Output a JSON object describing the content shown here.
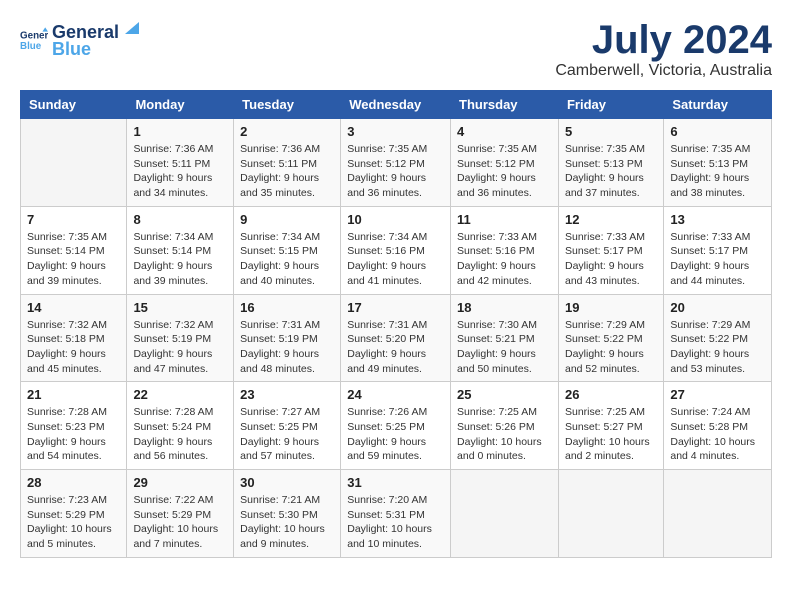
{
  "logo": {
    "line1": "General",
    "line2": "Blue"
  },
  "title": "July 2024",
  "subtitle": "Camberwell, Victoria, Australia",
  "days_header": [
    "Sunday",
    "Monday",
    "Tuesday",
    "Wednesday",
    "Thursday",
    "Friday",
    "Saturday"
  ],
  "weeks": [
    [
      {
        "num": "",
        "info": ""
      },
      {
        "num": "1",
        "info": "Sunrise: 7:36 AM\nSunset: 5:11 PM\nDaylight: 9 hours\nand 34 minutes."
      },
      {
        "num": "2",
        "info": "Sunrise: 7:36 AM\nSunset: 5:11 PM\nDaylight: 9 hours\nand 35 minutes."
      },
      {
        "num": "3",
        "info": "Sunrise: 7:35 AM\nSunset: 5:12 PM\nDaylight: 9 hours\nand 36 minutes."
      },
      {
        "num": "4",
        "info": "Sunrise: 7:35 AM\nSunset: 5:12 PM\nDaylight: 9 hours\nand 36 minutes."
      },
      {
        "num": "5",
        "info": "Sunrise: 7:35 AM\nSunset: 5:13 PM\nDaylight: 9 hours\nand 37 minutes."
      },
      {
        "num": "6",
        "info": "Sunrise: 7:35 AM\nSunset: 5:13 PM\nDaylight: 9 hours\nand 38 minutes."
      }
    ],
    [
      {
        "num": "7",
        "info": "Sunrise: 7:35 AM\nSunset: 5:14 PM\nDaylight: 9 hours\nand 39 minutes."
      },
      {
        "num": "8",
        "info": "Sunrise: 7:34 AM\nSunset: 5:14 PM\nDaylight: 9 hours\nand 39 minutes."
      },
      {
        "num": "9",
        "info": "Sunrise: 7:34 AM\nSunset: 5:15 PM\nDaylight: 9 hours\nand 40 minutes."
      },
      {
        "num": "10",
        "info": "Sunrise: 7:34 AM\nSunset: 5:16 PM\nDaylight: 9 hours\nand 41 minutes."
      },
      {
        "num": "11",
        "info": "Sunrise: 7:33 AM\nSunset: 5:16 PM\nDaylight: 9 hours\nand 42 minutes."
      },
      {
        "num": "12",
        "info": "Sunrise: 7:33 AM\nSunset: 5:17 PM\nDaylight: 9 hours\nand 43 minutes."
      },
      {
        "num": "13",
        "info": "Sunrise: 7:33 AM\nSunset: 5:17 PM\nDaylight: 9 hours\nand 44 minutes."
      }
    ],
    [
      {
        "num": "14",
        "info": "Sunrise: 7:32 AM\nSunset: 5:18 PM\nDaylight: 9 hours\nand 45 minutes."
      },
      {
        "num": "15",
        "info": "Sunrise: 7:32 AM\nSunset: 5:19 PM\nDaylight: 9 hours\nand 47 minutes."
      },
      {
        "num": "16",
        "info": "Sunrise: 7:31 AM\nSunset: 5:19 PM\nDaylight: 9 hours\nand 48 minutes."
      },
      {
        "num": "17",
        "info": "Sunrise: 7:31 AM\nSunset: 5:20 PM\nDaylight: 9 hours\nand 49 minutes."
      },
      {
        "num": "18",
        "info": "Sunrise: 7:30 AM\nSunset: 5:21 PM\nDaylight: 9 hours\nand 50 minutes."
      },
      {
        "num": "19",
        "info": "Sunrise: 7:29 AM\nSunset: 5:22 PM\nDaylight: 9 hours\nand 52 minutes."
      },
      {
        "num": "20",
        "info": "Sunrise: 7:29 AM\nSunset: 5:22 PM\nDaylight: 9 hours\nand 53 minutes."
      }
    ],
    [
      {
        "num": "21",
        "info": "Sunrise: 7:28 AM\nSunset: 5:23 PM\nDaylight: 9 hours\nand 54 minutes."
      },
      {
        "num": "22",
        "info": "Sunrise: 7:28 AM\nSunset: 5:24 PM\nDaylight: 9 hours\nand 56 minutes."
      },
      {
        "num": "23",
        "info": "Sunrise: 7:27 AM\nSunset: 5:25 PM\nDaylight: 9 hours\nand 57 minutes."
      },
      {
        "num": "24",
        "info": "Sunrise: 7:26 AM\nSunset: 5:25 PM\nDaylight: 9 hours\nand 59 minutes."
      },
      {
        "num": "25",
        "info": "Sunrise: 7:25 AM\nSunset: 5:26 PM\nDaylight: 10 hours\nand 0 minutes."
      },
      {
        "num": "26",
        "info": "Sunrise: 7:25 AM\nSunset: 5:27 PM\nDaylight: 10 hours\nand 2 minutes."
      },
      {
        "num": "27",
        "info": "Sunrise: 7:24 AM\nSunset: 5:28 PM\nDaylight: 10 hours\nand 4 minutes."
      }
    ],
    [
      {
        "num": "28",
        "info": "Sunrise: 7:23 AM\nSunset: 5:29 PM\nDaylight: 10 hours\nand 5 minutes."
      },
      {
        "num": "29",
        "info": "Sunrise: 7:22 AM\nSunset: 5:29 PM\nDaylight: 10 hours\nand 7 minutes."
      },
      {
        "num": "30",
        "info": "Sunrise: 7:21 AM\nSunset: 5:30 PM\nDaylight: 10 hours\nand 9 minutes."
      },
      {
        "num": "31",
        "info": "Sunrise: 7:20 AM\nSunset: 5:31 PM\nDaylight: 10 hours\nand 10 minutes."
      },
      {
        "num": "",
        "info": ""
      },
      {
        "num": "",
        "info": ""
      },
      {
        "num": "",
        "info": ""
      }
    ]
  ]
}
